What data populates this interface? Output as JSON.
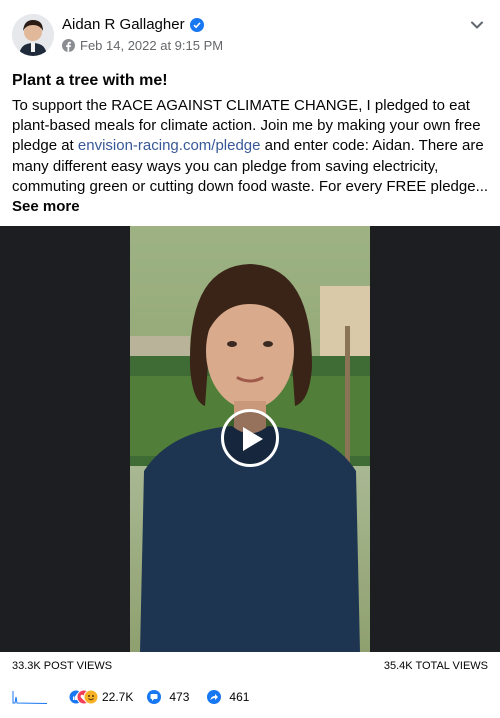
{
  "post": {
    "author": "Aidan R Gallagher",
    "date": "Feb 14, 2022 at 9:15 PM",
    "title": "Plant a tree with me!",
    "body_part1": "To support the RACE AGAINST CLIMATE CHANGE, I pledged to eat plant-based meals for climate action. Join me by making your own free pledge at ",
    "link_text": "envision-racing.com/pledge",
    "body_part2": " and enter code: Aidan. There are many different easy ways you can pledge from saving electricity, commuting green or cutting down food waste. For every FREE pledge...",
    "see_more": "See more"
  },
  "stats": {
    "post_views": "33.3K POST VIEWS",
    "total_views": "35.4K TOTAL VIEWS",
    "reactions": "22.7K",
    "comments": "473",
    "shares": "461"
  },
  "colors": {
    "verified": "#1877f2",
    "link": "#385898",
    "like": "#1877f2",
    "love": "#f33e58",
    "care": "#f7b125"
  }
}
